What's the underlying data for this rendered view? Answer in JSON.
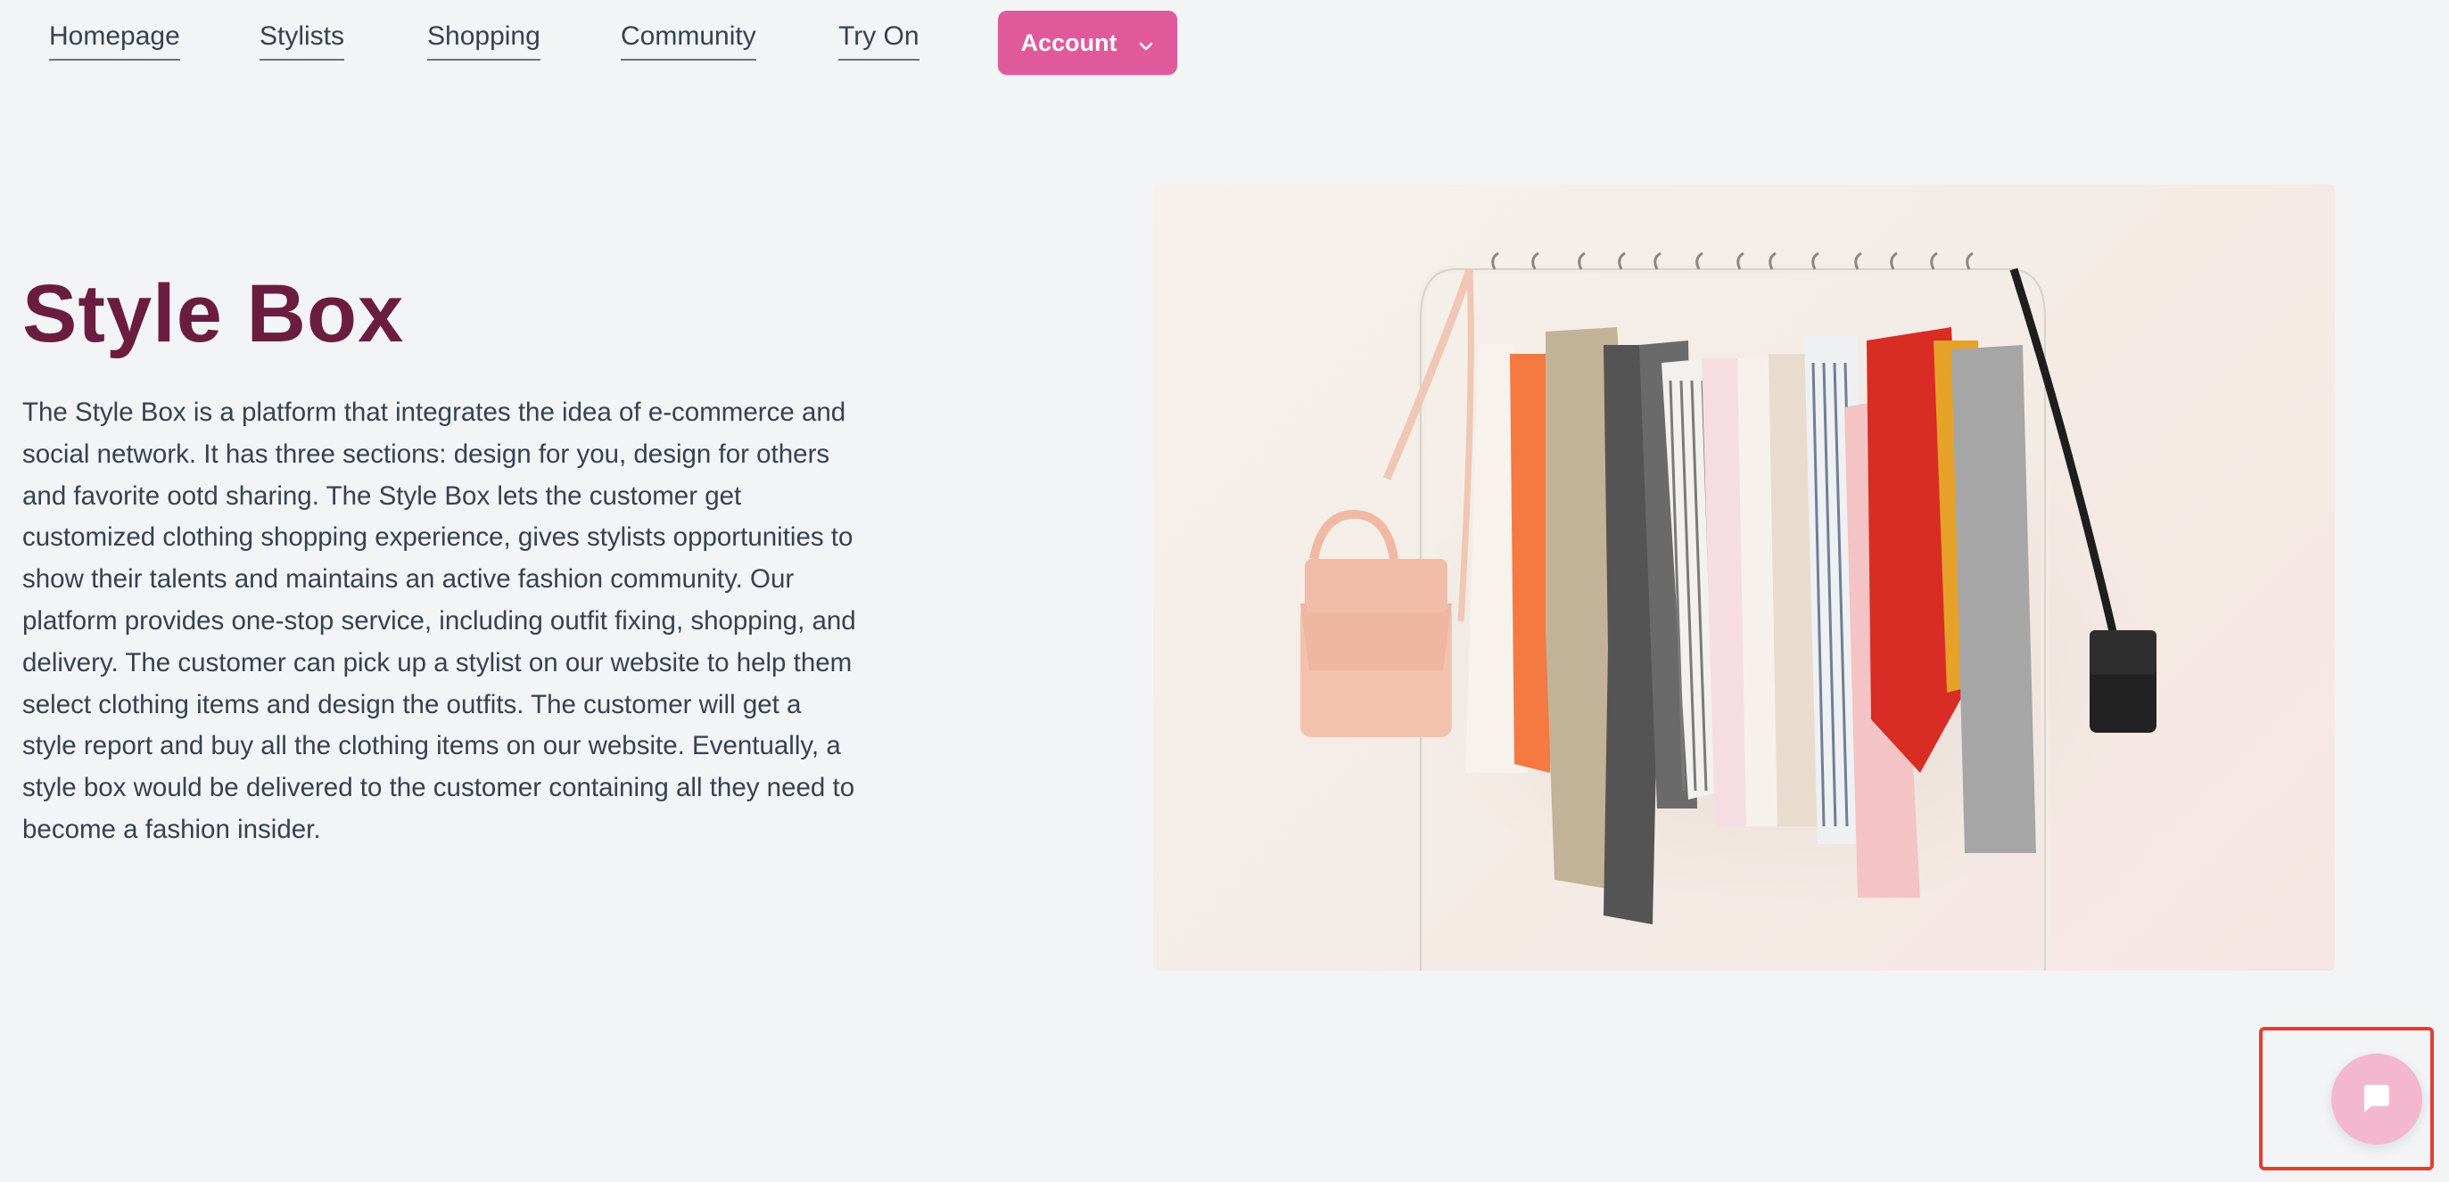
{
  "nav": {
    "links": [
      {
        "label": "Homepage"
      },
      {
        "label": "Stylists"
      },
      {
        "label": "Shopping"
      },
      {
        "label": "Community"
      },
      {
        "label": "Try On"
      }
    ],
    "account_label": "Account",
    "account_icon": "chevron-down-icon"
  },
  "hero": {
    "title": "Style Box",
    "description": "The Style Box is a platform that integrates the idea of e-commerce and social network. It has three sections: design for you, design for others and favorite ootd sharing. The Style Box lets the customer get customized clothing shopping experience, gives stylists opportunities to show their talents and maintains an active fashion community. Our platform provides one-stop service, including outfit fixing, shopping, and delivery. The customer can pick up a stylist on our website to help them select clothing items and design the outfits. The customer will get a style report and buy all the clothing items on our website. Eventually, a style box would be delivered to the customer containing all they need to become a fashion insider.",
    "image_subject": "clothing-rack-photo"
  },
  "chat": {
    "icon": "chat-bubble-icon"
  },
  "colors": {
    "background": "#f3f4f6",
    "accent": "#e05a9b",
    "title": "#6b1d3f",
    "chat_button": "#f3b8cd",
    "highlight": "#e53e2e"
  }
}
